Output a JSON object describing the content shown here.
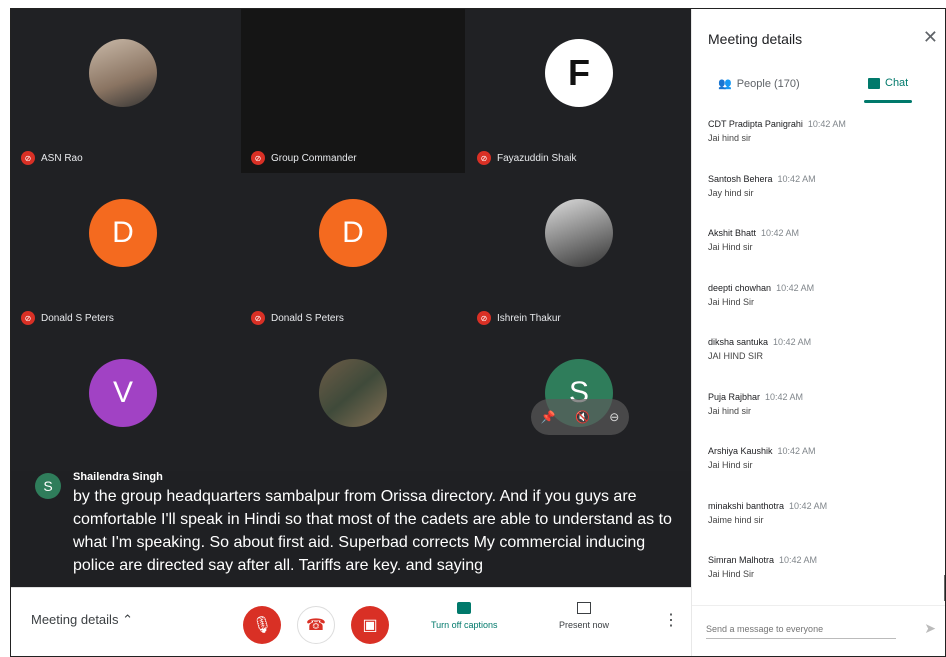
{
  "tiles": [
    {
      "name": "ASN Rao",
      "initial": "",
      "color": "",
      "style": "photo1"
    },
    {
      "name": "Group Commander",
      "initial": "",
      "color": "",
      "style": "empty"
    },
    {
      "name": "Fayazuddin Shaik",
      "initial": "F",
      "color": "#ffffff",
      "style": "photoF"
    },
    {
      "name": "Donald S Peters",
      "initial": "D",
      "color": "#f46a1f",
      "style": "letter"
    },
    {
      "name": "Donald S Peters",
      "initial": "D",
      "color": "#f46a1f",
      "style": "letter"
    },
    {
      "name": "Ishrein Thakur",
      "initial": "",
      "color": "",
      "style": "photoG"
    },
    {
      "name": "",
      "initial": "V",
      "color": "#a142c4",
      "style": "letter"
    },
    {
      "name": "",
      "initial": "",
      "color": "",
      "style": "photoV"
    },
    {
      "name": "",
      "initial": "S",
      "color": "#2f7d5b",
      "style": "letter"
    }
  ],
  "captions": {
    "avatar_initial": "S",
    "speaker": "Shailendra Singh",
    "text": "by the group headquarters sambalpur from Orissa directory. And if you guys are comfortable I'll speak in Hindi so that most of the cadets are able to understand as to what I'm speaking. So about first aid. Superbad corrects My commercial inducing police are directed say after all. Tariffs are key. and saying"
  },
  "bottom_bar": {
    "meeting_details": "Meeting details",
    "captions_label": "Turn off captions",
    "present_label": "Present now"
  },
  "panel": {
    "title": "Meeting details",
    "people_tab": "People (170)",
    "chat_tab": "Chat",
    "messages": [
      {
        "who": "CDT Pradipta Panigrahi",
        "time": "10:42 AM",
        "text": "Jai hind sir"
      },
      {
        "who": "Santosh Behera",
        "time": "10:42 AM",
        "text": "Jay hind sir"
      },
      {
        "who": "Akshit Bhatt",
        "time": "10:42 AM",
        "text": "Jai Hind sir"
      },
      {
        "who": "deepti chowhan",
        "time": "10:42 AM",
        "text": "Jai Hind Sir"
      },
      {
        "who": "diksha santuka",
        "time": "10:42 AM",
        "text": "JAI HIND SIR"
      },
      {
        "who": "Puja Rajbhar",
        "time": "10:42 AM",
        "text": "Jai hind sir"
      },
      {
        "who": "Arshiya Kaushik",
        "time": "10:42 AM",
        "text": "Jai Hind sir"
      },
      {
        "who": "minakshi banthotra",
        "time": "10:42 AM",
        "text": "Jaime hind sir"
      },
      {
        "who": "Simran Malhotra",
        "time": "10:42 AM",
        "text": "Jai Hind Sir"
      }
    ],
    "input_placeholder": "Send a message to everyone"
  },
  "colors": {
    "accent": "#00796b",
    "end_call": "#d93025",
    "stage_bg": "#202124"
  }
}
